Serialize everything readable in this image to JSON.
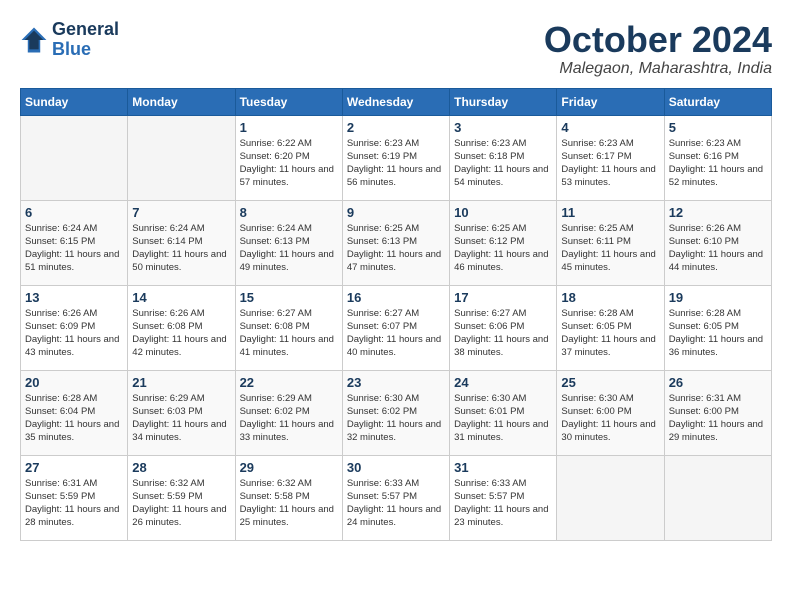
{
  "header": {
    "logo_line1": "General",
    "logo_line2": "Blue",
    "month": "October 2024",
    "location": "Malegaon, Maharashtra, India"
  },
  "weekdays": [
    "Sunday",
    "Monday",
    "Tuesday",
    "Wednesday",
    "Thursday",
    "Friday",
    "Saturday"
  ],
  "weeks": [
    [
      {
        "day": "",
        "info": ""
      },
      {
        "day": "",
        "info": ""
      },
      {
        "day": "1",
        "info": "Sunrise: 6:22 AM\nSunset: 6:20 PM\nDaylight: 11 hours and 57 minutes."
      },
      {
        "day": "2",
        "info": "Sunrise: 6:23 AM\nSunset: 6:19 PM\nDaylight: 11 hours and 56 minutes."
      },
      {
        "day": "3",
        "info": "Sunrise: 6:23 AM\nSunset: 6:18 PM\nDaylight: 11 hours and 54 minutes."
      },
      {
        "day": "4",
        "info": "Sunrise: 6:23 AM\nSunset: 6:17 PM\nDaylight: 11 hours and 53 minutes."
      },
      {
        "day": "5",
        "info": "Sunrise: 6:23 AM\nSunset: 6:16 PM\nDaylight: 11 hours and 52 minutes."
      }
    ],
    [
      {
        "day": "6",
        "info": "Sunrise: 6:24 AM\nSunset: 6:15 PM\nDaylight: 11 hours and 51 minutes."
      },
      {
        "day": "7",
        "info": "Sunrise: 6:24 AM\nSunset: 6:14 PM\nDaylight: 11 hours and 50 minutes."
      },
      {
        "day": "8",
        "info": "Sunrise: 6:24 AM\nSunset: 6:13 PM\nDaylight: 11 hours and 49 minutes."
      },
      {
        "day": "9",
        "info": "Sunrise: 6:25 AM\nSunset: 6:13 PM\nDaylight: 11 hours and 47 minutes."
      },
      {
        "day": "10",
        "info": "Sunrise: 6:25 AM\nSunset: 6:12 PM\nDaylight: 11 hours and 46 minutes."
      },
      {
        "day": "11",
        "info": "Sunrise: 6:25 AM\nSunset: 6:11 PM\nDaylight: 11 hours and 45 minutes."
      },
      {
        "day": "12",
        "info": "Sunrise: 6:26 AM\nSunset: 6:10 PM\nDaylight: 11 hours and 44 minutes."
      }
    ],
    [
      {
        "day": "13",
        "info": "Sunrise: 6:26 AM\nSunset: 6:09 PM\nDaylight: 11 hours and 43 minutes."
      },
      {
        "day": "14",
        "info": "Sunrise: 6:26 AM\nSunset: 6:08 PM\nDaylight: 11 hours and 42 minutes."
      },
      {
        "day": "15",
        "info": "Sunrise: 6:27 AM\nSunset: 6:08 PM\nDaylight: 11 hours and 41 minutes."
      },
      {
        "day": "16",
        "info": "Sunrise: 6:27 AM\nSunset: 6:07 PM\nDaylight: 11 hours and 40 minutes."
      },
      {
        "day": "17",
        "info": "Sunrise: 6:27 AM\nSunset: 6:06 PM\nDaylight: 11 hours and 38 minutes."
      },
      {
        "day": "18",
        "info": "Sunrise: 6:28 AM\nSunset: 6:05 PM\nDaylight: 11 hours and 37 minutes."
      },
      {
        "day": "19",
        "info": "Sunrise: 6:28 AM\nSunset: 6:05 PM\nDaylight: 11 hours and 36 minutes."
      }
    ],
    [
      {
        "day": "20",
        "info": "Sunrise: 6:28 AM\nSunset: 6:04 PM\nDaylight: 11 hours and 35 minutes."
      },
      {
        "day": "21",
        "info": "Sunrise: 6:29 AM\nSunset: 6:03 PM\nDaylight: 11 hours and 34 minutes."
      },
      {
        "day": "22",
        "info": "Sunrise: 6:29 AM\nSunset: 6:02 PM\nDaylight: 11 hours and 33 minutes."
      },
      {
        "day": "23",
        "info": "Sunrise: 6:30 AM\nSunset: 6:02 PM\nDaylight: 11 hours and 32 minutes."
      },
      {
        "day": "24",
        "info": "Sunrise: 6:30 AM\nSunset: 6:01 PM\nDaylight: 11 hours and 31 minutes."
      },
      {
        "day": "25",
        "info": "Sunrise: 6:30 AM\nSunset: 6:00 PM\nDaylight: 11 hours and 30 minutes."
      },
      {
        "day": "26",
        "info": "Sunrise: 6:31 AM\nSunset: 6:00 PM\nDaylight: 11 hours and 29 minutes."
      }
    ],
    [
      {
        "day": "27",
        "info": "Sunrise: 6:31 AM\nSunset: 5:59 PM\nDaylight: 11 hours and 28 minutes."
      },
      {
        "day": "28",
        "info": "Sunrise: 6:32 AM\nSunset: 5:59 PM\nDaylight: 11 hours and 26 minutes."
      },
      {
        "day": "29",
        "info": "Sunrise: 6:32 AM\nSunset: 5:58 PM\nDaylight: 11 hours and 25 minutes."
      },
      {
        "day": "30",
        "info": "Sunrise: 6:33 AM\nSunset: 5:57 PM\nDaylight: 11 hours and 24 minutes."
      },
      {
        "day": "31",
        "info": "Sunrise: 6:33 AM\nSunset: 5:57 PM\nDaylight: 11 hours and 23 minutes."
      },
      {
        "day": "",
        "info": ""
      },
      {
        "day": "",
        "info": ""
      }
    ]
  ]
}
